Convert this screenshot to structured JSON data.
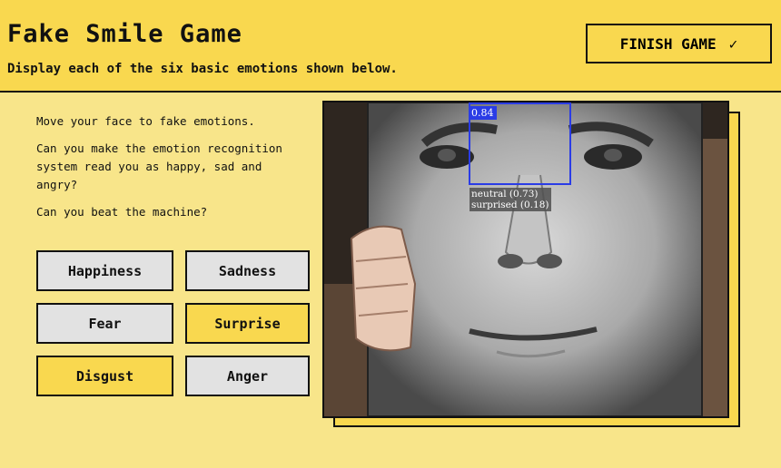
{
  "header": {
    "title": "Fake Smile Game",
    "subtitle": "Display each of the six basic emotions shown below.",
    "finish_label": "FINISH GAME",
    "finish_icon": "✓"
  },
  "instructions": [
    "Move your face to fake emotions.",
    "Can you make the emotion recognition system read you as happy, sad and angry?",
    "Can you beat the machine?"
  ],
  "emotions": [
    {
      "label": "Happiness",
      "state": "active"
    },
    {
      "label": "Sadness",
      "state": "active"
    },
    {
      "label": "Fear",
      "state": "active"
    },
    {
      "label": "Surprise",
      "state": "idle"
    },
    {
      "label": "Disgust",
      "state": "idle"
    },
    {
      "label": "Anger",
      "state": "active"
    }
  ],
  "detection": {
    "score": "0.84",
    "readout_line1": "neutral (0.73)",
    "readout_line2": "surprised (0.18)"
  },
  "colors": {
    "header_bg": "#f9d84f",
    "page_bg": "#f8e58a",
    "button_active": "#e2e2e2",
    "detect_box": "#2a3ce6"
  }
}
